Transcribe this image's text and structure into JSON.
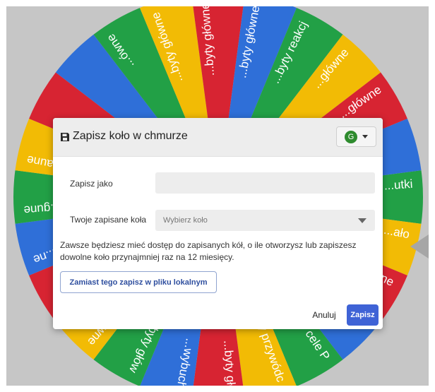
{
  "wheel": {
    "segment_colors": [
      "#22a046",
      "#f2bb05",
      "#d72432",
      "#2f6fd8"
    ],
    "labels": [
      {
        "text": "...ówne",
        "angle": 236
      },
      {
        "text": "...byty główne",
        "angle": 251
      },
      {
        "text": "...byty główne",
        "angle": 266
      },
      {
        "text": "...byty główne",
        "angle": 281
      },
      {
        "text": "...byty reakcj",
        "angle": 296
      },
      {
        "text": "...główne",
        "angle": 311
      },
      {
        "text": "...główne",
        "angle": 326
      },
      {
        "text": "...utki",
        "angle": 356
      },
      {
        "text": "...ało",
        "angle": 11
      },
      {
        "text": "...ne",
        "angle": 26
      },
      {
        "text": "...byty cele P",
        "angle": 56
      },
      {
        "text": "...byty przywódc",
        "angle": 71
      },
      {
        "text": "...byty głó",
        "angle": 86
      },
      {
        "text": "...wybuch",
        "angle": 101
      },
      {
        "text": "...byty głów",
        "angle": 116
      },
      {
        "text": "...byty główne",
        "angle": 131
      },
      {
        "text": "...główne",
        "angle": 146
      },
      {
        "text": "...ne",
        "angle": 161
      },
      {
        "text": "...gune",
        "angle": 176
      },
      {
        "text": "...aune",
        "angle": 191
      }
    ]
  },
  "modal": {
    "title": "Zapisz koło w chmurze",
    "title_icon": "floppy-disk-icon",
    "account": {
      "avatar_letter": "G",
      "avatar_color": "#2e8b2e"
    },
    "save_as": {
      "label": "Zapisz jako",
      "value": "",
      "placeholder": ""
    },
    "saved_wheels": {
      "label": "Twoje zapisane koła",
      "placeholder": "Wybierz koło"
    },
    "info_text": "Zawsze będziesz mieć dostęp do zapisanych kół, o ile otworzysz lub zapiszesz dowolne koło przynajmniej raz na 12 miesięcy.",
    "local_save_label": "Zamiast tego zapisz w pliku lokalnym",
    "cancel_label": "Anuluj",
    "save_label": "Zapisz",
    "accent_color": "#3f63d6"
  }
}
